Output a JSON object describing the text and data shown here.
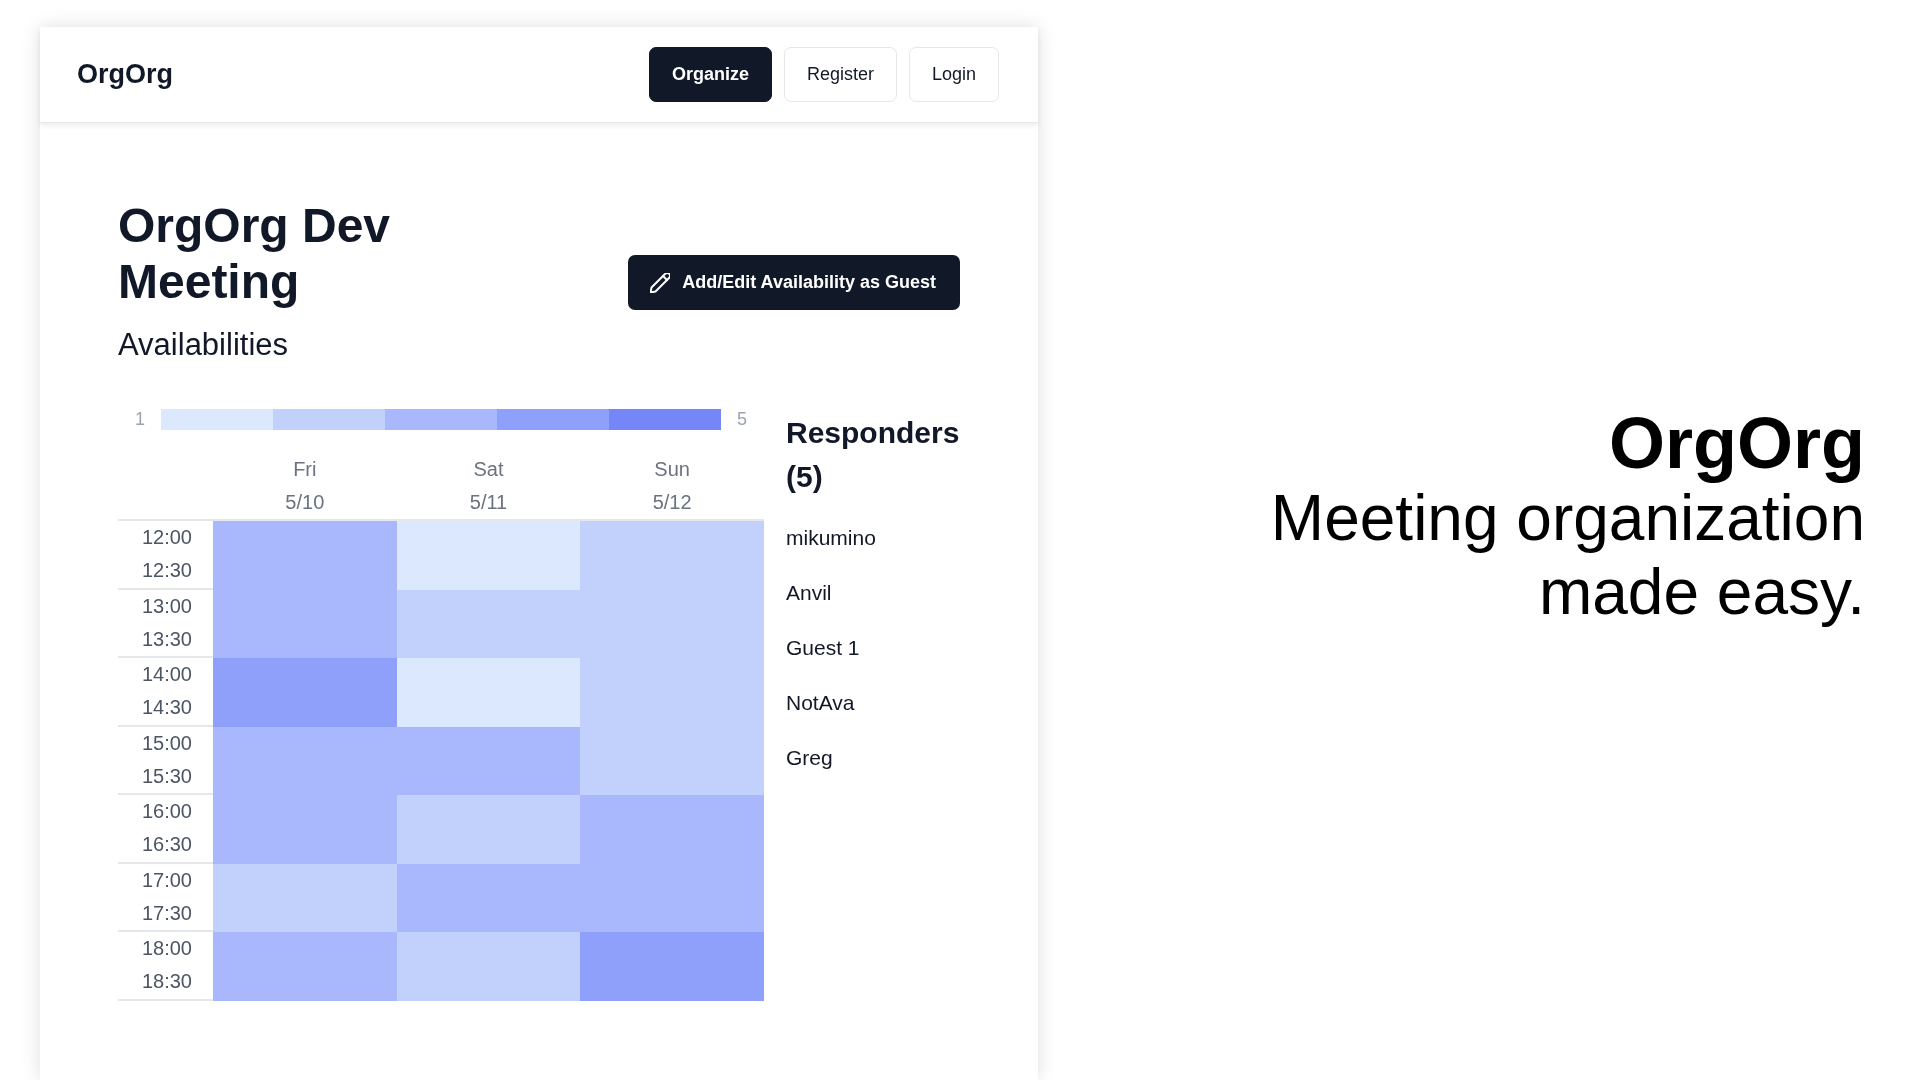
{
  "app_preview": {
    "navbar": {
      "logo": "OrgOrg",
      "buttons": [
        {
          "label": "Organize",
          "kind": "primary"
        },
        {
          "label": "Register",
          "kind": "outline"
        },
        {
          "label": "Login",
          "kind": "outline"
        }
      ]
    },
    "event": {
      "title": "OrgOrg Dev Meeting",
      "subtitle": "Availabilities",
      "action_button": {
        "label": "Add/Edit Availability as Guest"
      }
    },
    "heatmap": {
      "legend": {
        "min_label": "1",
        "max_label": "5",
        "steps": [
          {
            "color": "#dbe8fd"
          },
          {
            "color": "#c1d1fb"
          },
          {
            "color": "#a9b8fc"
          },
          {
            "color": "#8ea0f9"
          },
          {
            "color": "#7586f9"
          }
        ]
      },
      "days": [
        {
          "weekday": "Fri",
          "date": "5/10"
        },
        {
          "weekday": "Sat",
          "date": "5/11"
        },
        {
          "weekday": "Sun",
          "date": "5/12"
        }
      ],
      "rows": [
        {
          "times": [
            "12:00",
            "12:30"
          ],
          "cells": [
            {
              "color": "#a9b8fc"
            },
            {
              "color": "#dbe8fd"
            },
            {
              "color": "#c1d1fb"
            }
          ]
        },
        {
          "times": [
            "13:00",
            "13:30"
          ],
          "cells": [
            {
              "color": "#a9b8fc"
            },
            {
              "color": "#c1d1fb"
            },
            {
              "color": "#c1d1fb"
            }
          ]
        },
        {
          "times": [
            "14:00",
            "14:30"
          ],
          "cells": [
            {
              "color": "#8ea0f9"
            },
            {
              "color": "#dbe8fd"
            },
            {
              "color": "#c1d1fb"
            }
          ]
        },
        {
          "times": [
            "15:00",
            "15:30"
          ],
          "cells": [
            {
              "color": "#a9b8fc"
            },
            {
              "color": "#a9b8fc"
            },
            {
              "color": "#c1d1fb"
            }
          ]
        },
        {
          "times": [
            "16:00",
            "16:30"
          ],
          "cells": [
            {
              "color": "#a9b8fc"
            },
            {
              "color": "#c1d1fb"
            },
            {
              "color": "#a9b8fc"
            }
          ]
        },
        {
          "times": [
            "17:00",
            "17:30"
          ],
          "cells": [
            {
              "color": "#c1d1fb"
            },
            {
              "color": "#a9b8fc"
            },
            {
              "color": "#a9b8fc"
            }
          ]
        },
        {
          "times": [
            "18:00",
            "18:30"
          ],
          "cells": [
            {
              "color": "#a9b8fc"
            },
            {
              "color": "#c1d1fb"
            },
            {
              "color": "#8ea0f9"
            }
          ]
        }
      ]
    },
    "responders": {
      "title": "Responders (5)",
      "names": [
        "mikumino",
        "Anvil",
        "Guest 1",
        "NotAva",
        "Greg"
      ]
    }
  },
  "tagline": {
    "title": "OrgOrg",
    "text": "Meeting organization made easy."
  }
}
